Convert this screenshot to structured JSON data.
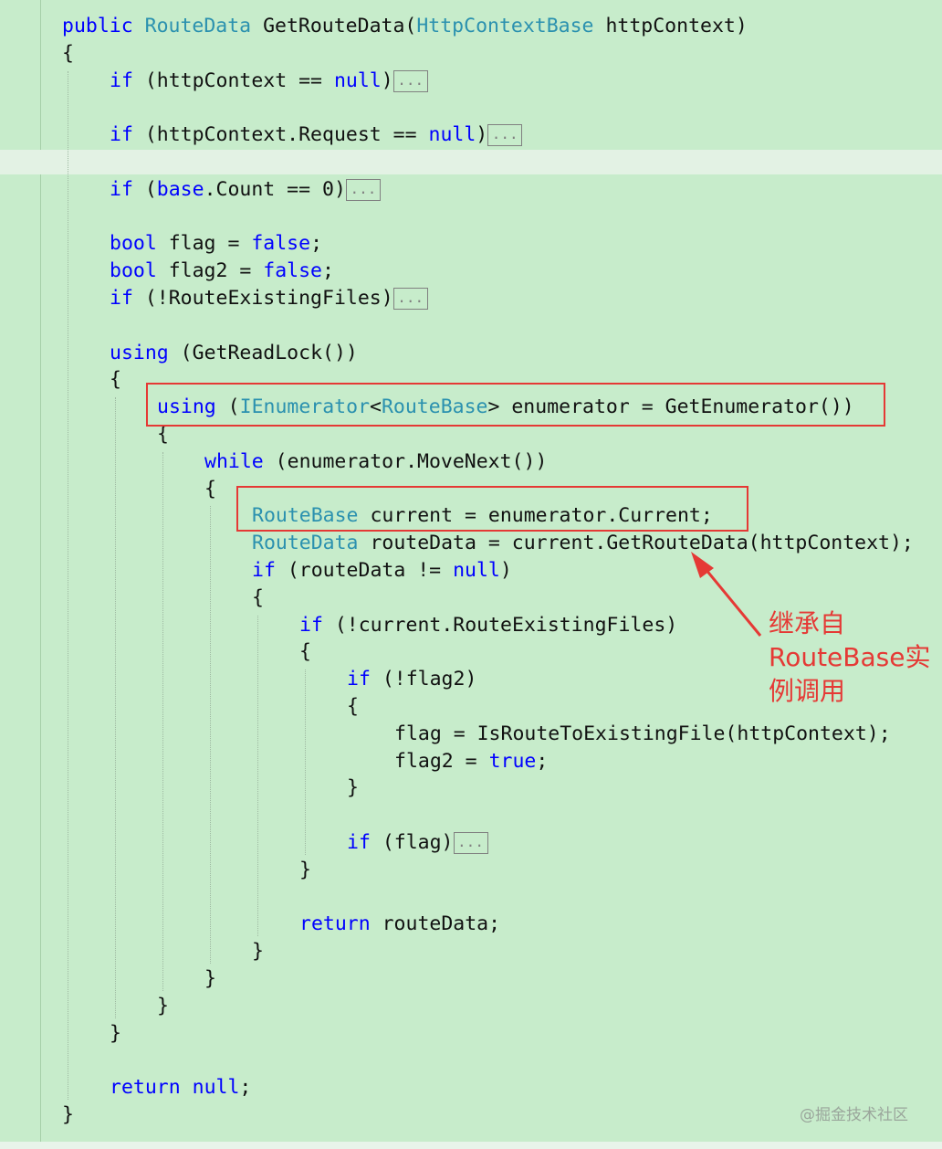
{
  "editor": {
    "lines": [
      {
        "indent": 0,
        "parts": [
          {
            "t": "public",
            "c": "kw"
          },
          {
            "t": " "
          },
          {
            "t": "RouteData",
            "c": "ty"
          },
          {
            "t": " GetRouteData("
          },
          {
            "t": "HttpContextBase",
            "c": "ty"
          },
          {
            "t": " httpContext)"
          }
        ]
      },
      {
        "indent": 0,
        "parts": [
          {
            "t": "{"
          }
        ]
      },
      {
        "indent": 1,
        "parts": [
          {
            "t": "if",
            "c": "kw"
          },
          {
            "t": " (httpContext == "
          },
          {
            "t": "null",
            "c": "kw"
          },
          {
            "t": ")"
          }
        ],
        "fold": true
      },
      {
        "indent": 1,
        "parts": []
      },
      {
        "indent": 1,
        "parts": [
          {
            "t": "if",
            "c": "kw"
          },
          {
            "t": " (httpContext.Request == "
          },
          {
            "t": "null",
            "c": "kw"
          },
          {
            "t": ")"
          }
        ],
        "fold": true
      },
      {
        "indent": 1,
        "parts": []
      },
      {
        "indent": 1,
        "parts": [
          {
            "t": "if",
            "c": "kw"
          },
          {
            "t": " ("
          },
          {
            "t": "base",
            "c": "kw"
          },
          {
            "t": ".Count == 0)"
          }
        ],
        "fold": true
      },
      {
        "indent": 1,
        "parts": []
      },
      {
        "indent": 1,
        "parts": [
          {
            "t": "bool",
            "c": "kw"
          },
          {
            "t": " flag = "
          },
          {
            "t": "false",
            "c": "kw"
          },
          {
            "t": ";"
          }
        ]
      },
      {
        "indent": 1,
        "parts": [
          {
            "t": "bool",
            "c": "kw"
          },
          {
            "t": " flag2 = "
          },
          {
            "t": "false",
            "c": "kw"
          },
          {
            "t": ";"
          }
        ]
      },
      {
        "indent": 1,
        "parts": [
          {
            "t": "if",
            "c": "kw"
          },
          {
            "t": " (!RouteExistingFiles)"
          }
        ],
        "fold": true
      },
      {
        "indent": 1,
        "parts": []
      },
      {
        "indent": 1,
        "parts": [
          {
            "t": "using",
            "c": "kw"
          },
          {
            "t": " (GetReadLock())"
          }
        ]
      },
      {
        "indent": 1,
        "parts": [
          {
            "t": "{"
          }
        ]
      },
      {
        "indent": 2,
        "parts": [
          {
            "t": "using",
            "c": "kw"
          },
          {
            "t": " ("
          },
          {
            "t": "IEnumerator",
            "c": "ty"
          },
          {
            "t": "<"
          },
          {
            "t": "RouteBase",
            "c": "ty"
          },
          {
            "t": "> enumerator = GetEnumerator())"
          }
        ]
      },
      {
        "indent": 2,
        "parts": [
          {
            "t": "{"
          }
        ]
      },
      {
        "indent": 3,
        "parts": [
          {
            "t": "while",
            "c": "kw"
          },
          {
            "t": " (enumerator.MoveNext())"
          }
        ]
      },
      {
        "indent": 3,
        "parts": [
          {
            "t": "{"
          }
        ]
      },
      {
        "indent": 4,
        "parts": [
          {
            "t": "RouteBase",
            "c": "ty"
          },
          {
            "t": " current = enumerator.Current;"
          }
        ]
      },
      {
        "indent": 4,
        "parts": [
          {
            "t": "RouteData",
            "c": "ty"
          },
          {
            "t": " routeData = current.GetRouteData(httpContext);"
          }
        ]
      },
      {
        "indent": 4,
        "parts": [
          {
            "t": "if",
            "c": "kw"
          },
          {
            "t": " (routeData != "
          },
          {
            "t": "null",
            "c": "kw"
          },
          {
            "t": ")"
          }
        ]
      },
      {
        "indent": 4,
        "parts": [
          {
            "t": "{"
          }
        ]
      },
      {
        "indent": 5,
        "parts": [
          {
            "t": "if",
            "c": "kw"
          },
          {
            "t": " (!current.RouteExistingFiles)"
          }
        ]
      },
      {
        "indent": 5,
        "parts": [
          {
            "t": "{"
          }
        ]
      },
      {
        "indent": 6,
        "parts": [
          {
            "t": "if",
            "c": "kw"
          },
          {
            "t": " (!flag2)"
          }
        ]
      },
      {
        "indent": 6,
        "parts": [
          {
            "t": "{"
          }
        ]
      },
      {
        "indent": 7,
        "parts": [
          {
            "t": "flag = IsRouteToExistingFile(httpContext);"
          }
        ]
      },
      {
        "indent": 7,
        "parts": [
          {
            "t": "flag2 = "
          },
          {
            "t": "true",
            "c": "kw"
          },
          {
            "t": ";"
          }
        ]
      },
      {
        "indent": 6,
        "parts": [
          {
            "t": "}"
          }
        ]
      },
      {
        "indent": 6,
        "parts": []
      },
      {
        "indent": 6,
        "parts": [
          {
            "t": "if",
            "c": "kw"
          },
          {
            "t": " (flag)"
          }
        ],
        "fold": true
      },
      {
        "indent": 5,
        "parts": [
          {
            "t": "}"
          }
        ]
      },
      {
        "indent": 5,
        "parts": []
      },
      {
        "indent": 5,
        "parts": [
          {
            "t": "return",
            "c": "kw"
          },
          {
            "t": " routeData;"
          }
        ]
      },
      {
        "indent": 4,
        "parts": [
          {
            "t": "}"
          }
        ]
      },
      {
        "indent": 3,
        "parts": [
          {
            "t": "}"
          }
        ]
      },
      {
        "indent": 2,
        "parts": [
          {
            "t": "}"
          }
        ]
      },
      {
        "indent": 1,
        "parts": [
          {
            "t": "}"
          }
        ]
      },
      {
        "indent": 1,
        "parts": []
      },
      {
        "indent": 1,
        "parts": [
          {
            "t": "return",
            "c": "kw"
          },
          {
            "t": " "
          },
          {
            "t": "null",
            "c": "kw"
          },
          {
            "t": ";"
          }
        ]
      },
      {
        "indent": 0,
        "parts": [
          {
            "t": "}"
          }
        ]
      }
    ],
    "fold_label": "...",
    "colors": {
      "background": "#c7eccb",
      "keyword": "#0000ff",
      "type": "#2b91af",
      "text": "#111111",
      "highlight": "#e53935"
    }
  },
  "annotation": {
    "lines": [
      "继承自",
      "RouteBase实",
      "例调用"
    ]
  },
  "watermark": "@掘金技术社区"
}
